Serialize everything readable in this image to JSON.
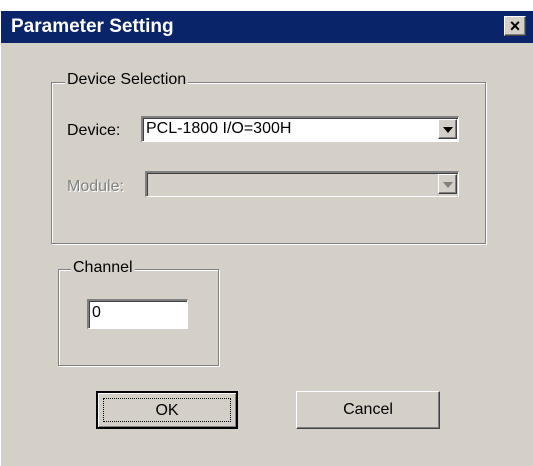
{
  "dialog": {
    "title": "Parameter Setting",
    "close_glyph": "×",
    "device_selection": {
      "group_label": "Device Selection",
      "device_label": "Device:",
      "device_value": "PCL-1800 I/O=300H",
      "module_label": "Module:",
      "module_value": ""
    },
    "channel": {
      "group_label": "Channel",
      "value": "0"
    },
    "buttons": {
      "ok": "OK",
      "cancel": "Cancel"
    }
  },
  "colors": {
    "titlebar": "#0a246a",
    "face": "#d4d0c8"
  }
}
